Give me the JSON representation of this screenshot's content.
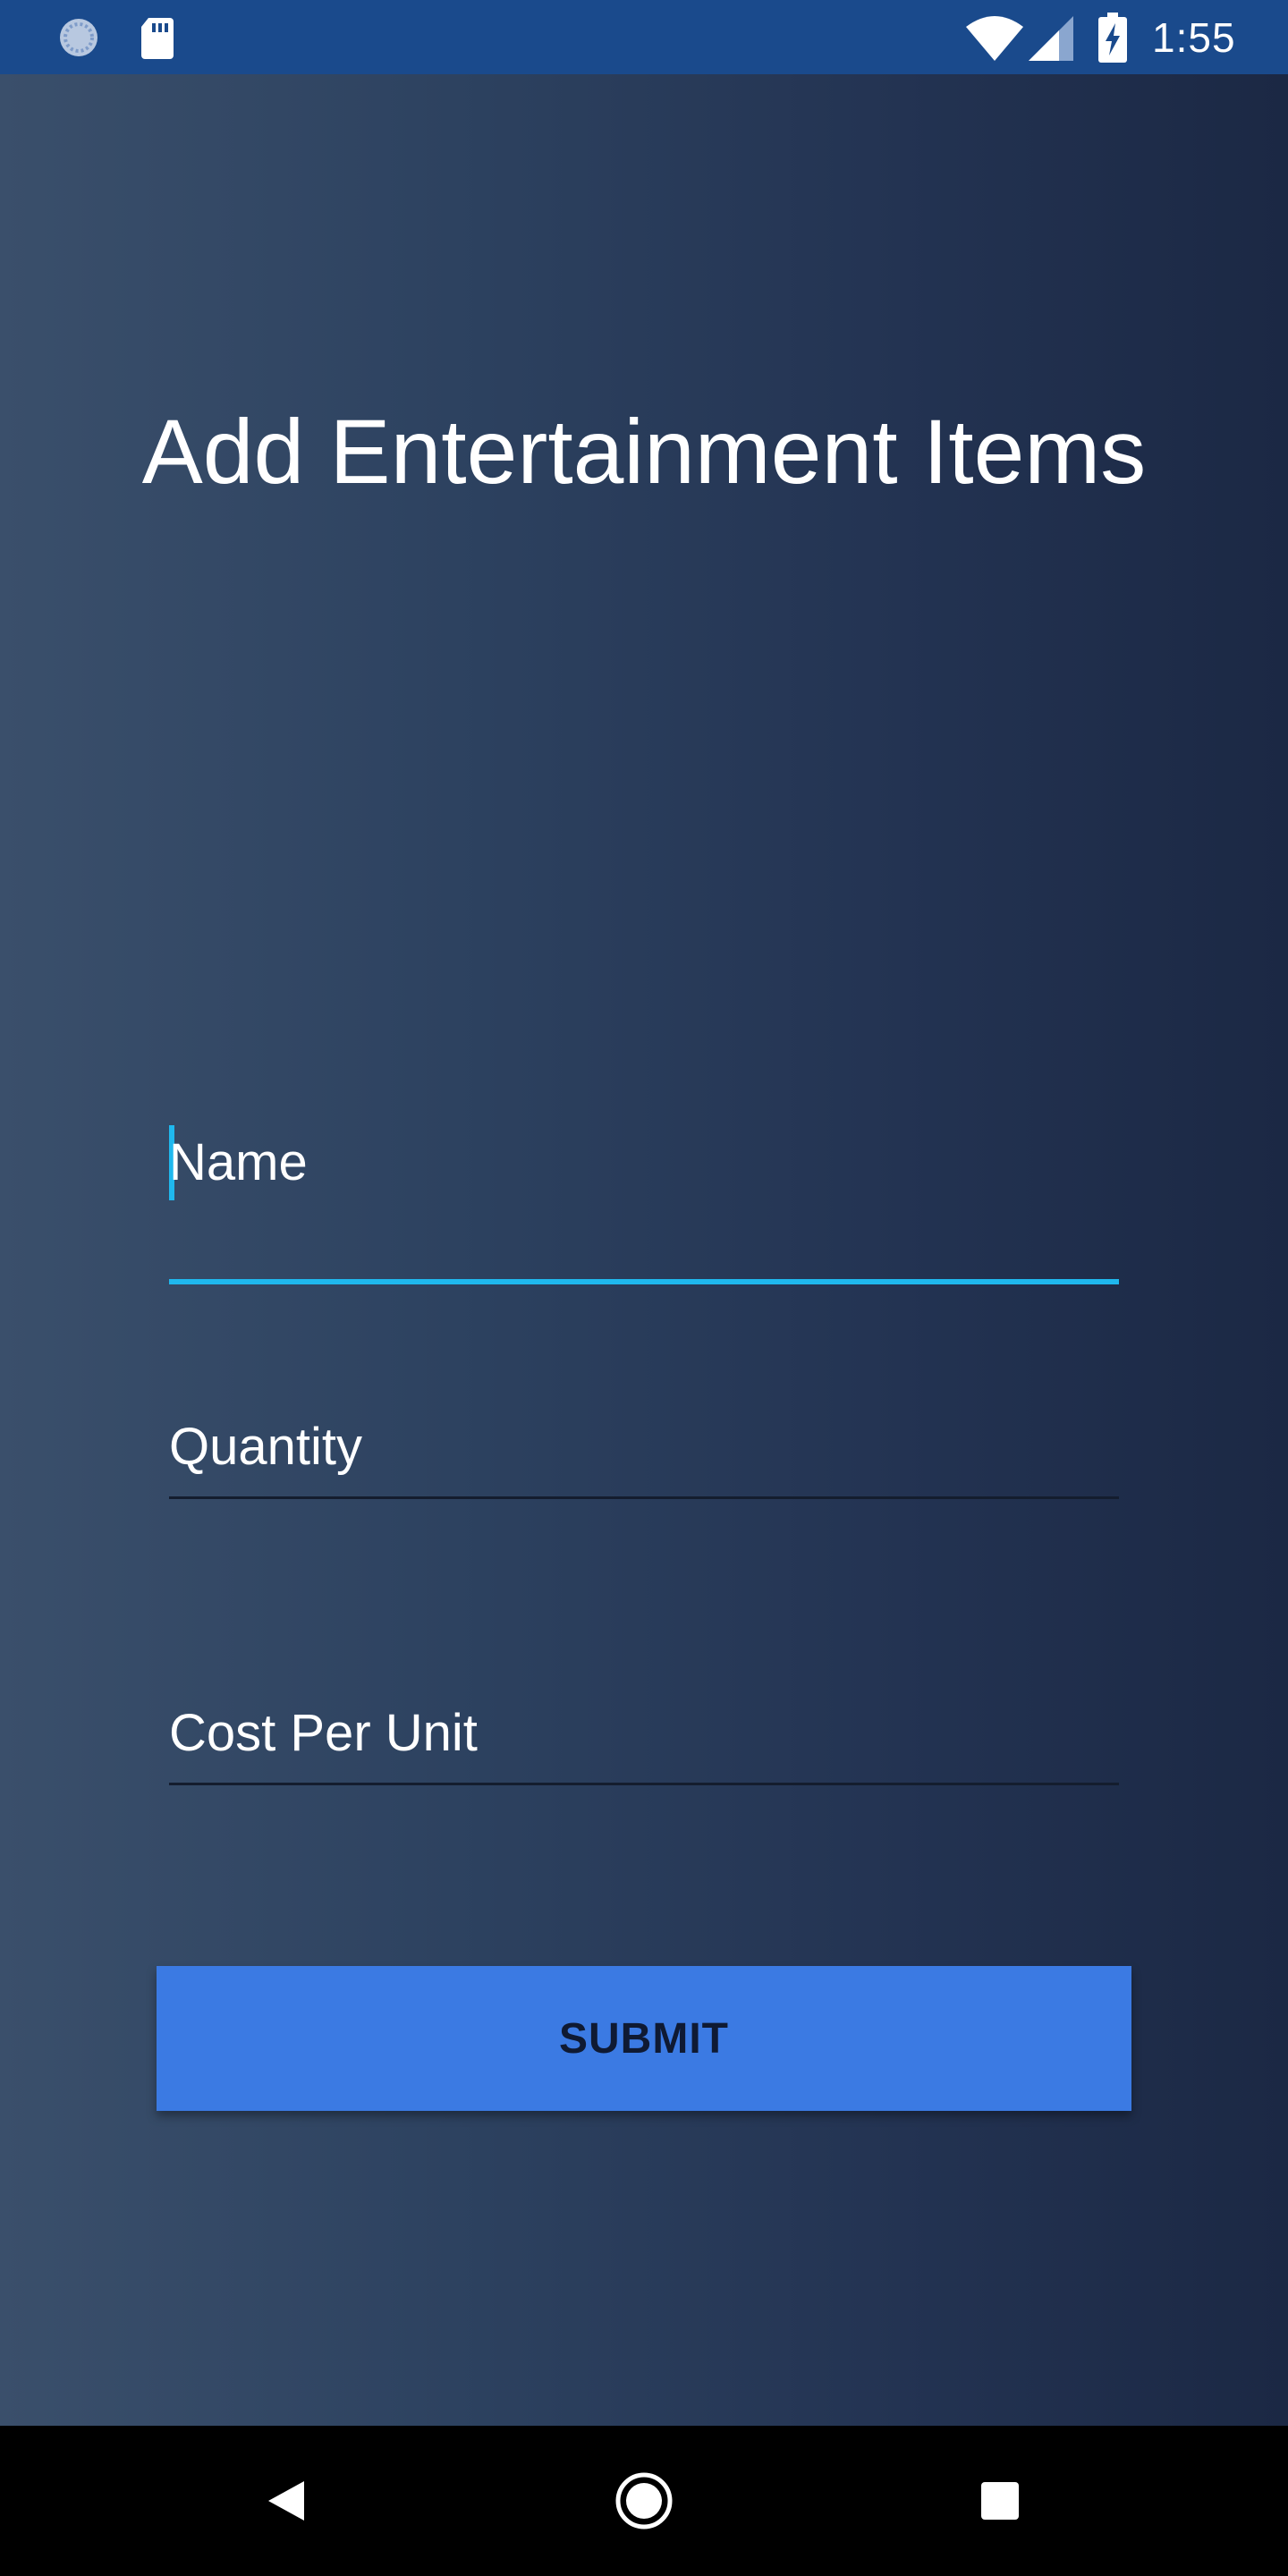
{
  "status_bar": {
    "time": "1:55",
    "left_icons": [
      "sync-icon",
      "sd-card-icon"
    ],
    "right_icons": [
      "wifi-icon",
      "cell-signal-icon",
      "battery-charging-icon"
    ],
    "background_color": "#1a4a8c"
  },
  "page": {
    "title": "Add Entertainment Items"
  },
  "form": {
    "fields": [
      {
        "label": "Name",
        "value": "",
        "focused": true
      },
      {
        "label": "Quantity",
        "value": "",
        "focused": false
      },
      {
        "label": "Cost Per Unit",
        "value": "",
        "focused": false
      }
    ],
    "accent_color": "#1fb8ee",
    "submit_label": "SUBMIT",
    "submit_color": "#3b7ae3"
  },
  "nav_bar": {
    "icons": [
      "back-icon",
      "home-icon",
      "recents-icon"
    ]
  }
}
